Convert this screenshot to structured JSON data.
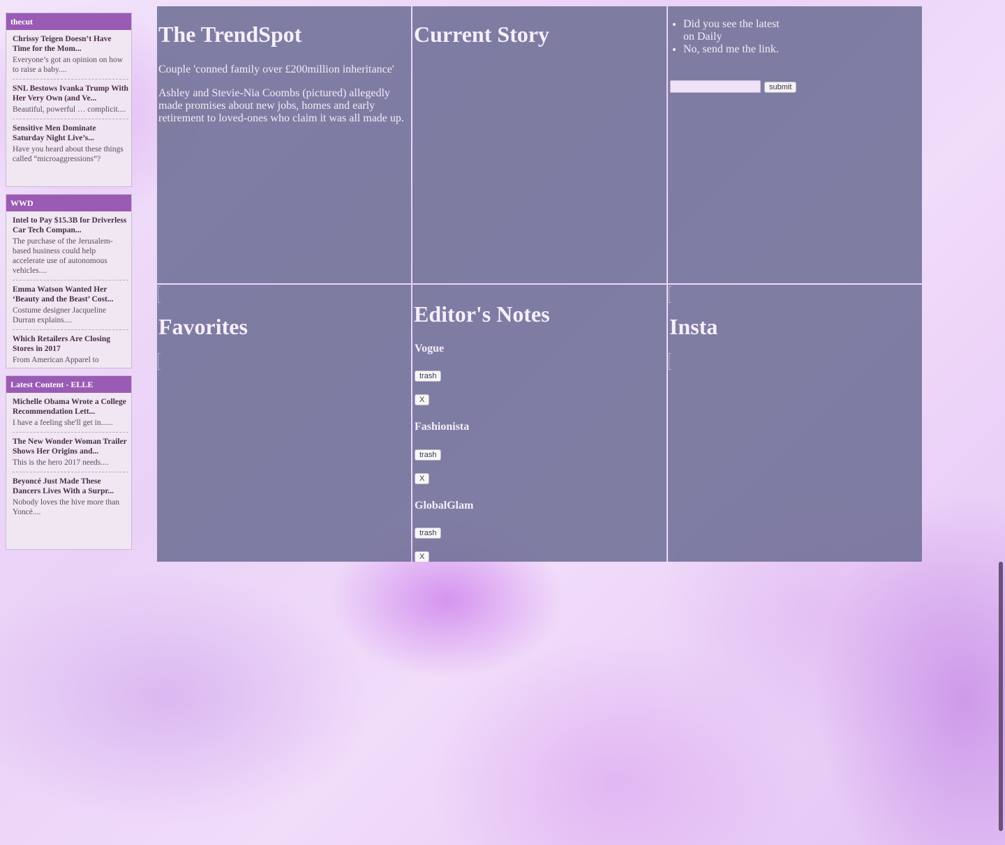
{
  "feeds": [
    {
      "name": "thecut",
      "items": [
        {
          "title": "Chrissy Teigen Doesn’t Have Time for the Mom...",
          "desc": "Everyone’s got an opinion on how to raise a baby...."
        },
        {
          "title": "SNL Bestows Ivanka Trump With Her Very Own (and Ve...",
          "desc": "Beautiful, powerful … complicit...."
        },
        {
          "title": "Sensitive Men Dominate Saturday Night Live’s...",
          "desc": "Have you heard about these things called “microaggressions”?"
        }
      ]
    },
    {
      "name": "WWD",
      "items": [
        {
          "title": "Intel to Pay $15.3B for Driverless Car Tech Compan...",
          "desc": "The purchase of the Jerusalem-based business could help accelerate use of autonomous vehicles...."
        },
        {
          "title": "Emma Watson Wanted Her ‘Beauty and the Beast’ Cost...",
          "desc": "Costume designer Jacqueline Durran explains...."
        },
        {
          "title": "Which Retailers Are Closing Stores in 2017",
          "desc": "From American Apparel to"
        }
      ]
    },
    {
      "name": "Latest Content - ELLE",
      "items": [
        {
          "title": "Michelle Obama Wrote a College Recommendation Lett...",
          "desc": "I have a feeling she'll get in......"
        },
        {
          "title": "The New Wonder Woman Trailer Shows Her Origins and...",
          "desc": "This is the hero 2017 needs...."
        },
        {
          "title": "Beyoncé Just Made These Dancers Lives With a Surpr...",
          "desc": "Nobody loves the hive more than Yoncé...."
        }
      ]
    }
  ],
  "trendspot": {
    "title": "The TrendSpot",
    "headline": "Couple 'conned family over £200million inheritance'",
    "body": "Ashley and Stevie-Nia Coombs (pictured) allegedly made promises about new jobs, homes and early retirement to loved-ones who claim it was all made up."
  },
  "current_story": {
    "title": "Current Story"
  },
  "chat": {
    "messages": [
      "Did you see the latest on Daily",
      "No, send me the link."
    ],
    "input_value": "",
    "submit_label": "submit"
  },
  "favorites": {
    "title": "Favorites"
  },
  "editors_notes": {
    "title": "Editor's Notes",
    "trash_label": "trash",
    "close_label": "X",
    "sources": [
      "Vogue",
      "Fashionista",
      "GlobalGlam"
    ]
  },
  "insta": {
    "title": "Insta"
  },
  "colors": {
    "feed_header": "#9a5bb4",
    "panel": "#707096",
    "background": "#ead2f7"
  }
}
